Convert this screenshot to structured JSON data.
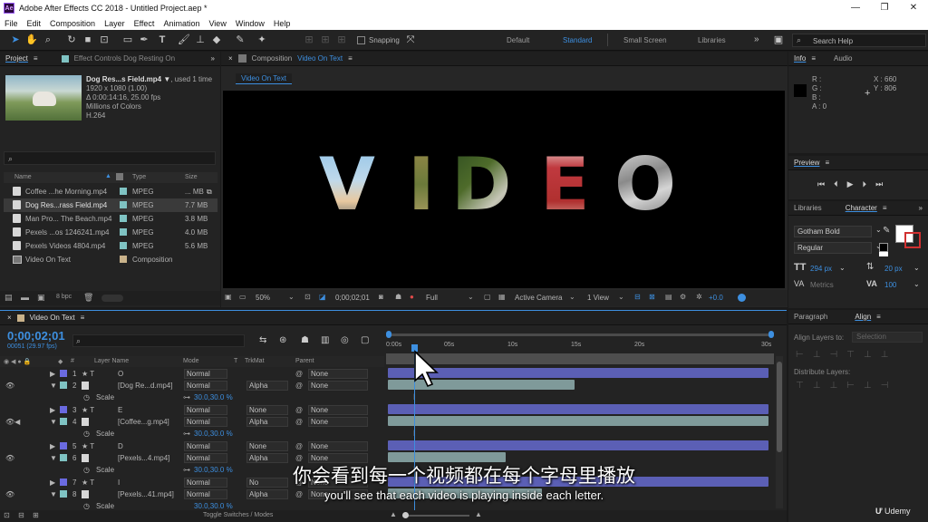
{
  "window": {
    "title": "Adobe After Effects CC 2018 - Untitled Project.aep *",
    "app_icon": "Ae",
    "minimize": "—",
    "restore": "❐",
    "close": "✕"
  },
  "menu": [
    "File",
    "Edit",
    "Composition",
    "Layer",
    "Effect",
    "Animation",
    "View",
    "Window",
    "Help"
  ],
  "toolbar": {
    "snapping": "Snapping",
    "workspaces": [
      "Default",
      "Standard",
      "Small Screen",
      "Libraries"
    ],
    "active_workspace": "Standard",
    "search_help": "Search Help"
  },
  "project": {
    "tab": "Project",
    "effect_controls": "Effect Controls Dog Resting On",
    "selected": {
      "name": "Dog Res...s Field.mp4",
      "used": ", used 1 time",
      "size": "1920 x 1080 (1.00)",
      "duration": "Δ 0:00:14:16, 25.00 fps",
      "colors": "Millions of Colors",
      "codec": "H.264"
    },
    "columns": {
      "name": "Name",
      "type": "Type",
      "size": "Size"
    },
    "items": [
      {
        "name": "Coffee ...he Morning.mp4",
        "type": "MPEG",
        "size": "... MB"
      },
      {
        "name": "Dog Res...rass Field.mp4",
        "type": "MPEG",
        "size": "7.7 MB"
      },
      {
        "name": "Man Pro... The Beach.mp4",
        "type": "MPEG",
        "size": "3.8 MB"
      },
      {
        "name": "Pexels ...os 1246241.mp4",
        "type": "MPEG",
        "size": "4.0 MB"
      },
      {
        "name": "Pexels Videos 4804.mp4",
        "type": "MPEG",
        "size": "5.6 MB"
      },
      {
        "name": "Video On Text",
        "type": "Composition",
        "size": ""
      }
    ],
    "bpc": "8 bpc"
  },
  "composition": {
    "header": "Composition",
    "name": "Video On Text",
    "tab": "Video On Text",
    "text": [
      "V",
      "I",
      "D",
      "E",
      "O"
    ],
    "zoom": "50%",
    "timecode": "0;00;02;01",
    "resolution": "Full",
    "camera": "Active Camera",
    "view": "1 View",
    "exposure": "+0.0"
  },
  "info": {
    "tab": "Info",
    "audio_tab": "Audio",
    "r": "R :",
    "g": "G :",
    "b": "B :",
    "a": "A : 0",
    "x": "X : 660",
    "y": "Y : 806"
  },
  "preview": {
    "tab": "Preview"
  },
  "character": {
    "libraries_tab": "Libraries",
    "tab": "Character",
    "font": "Gotham Bold",
    "style": "Regular",
    "size": "294 px",
    "leading": "20 px",
    "kerning": "Metrics",
    "tracking": "100"
  },
  "align": {
    "paragraph_tab": "Paragraph",
    "tab": "Align",
    "align_to_label": "Align Layers to:",
    "align_to_value": "Selection",
    "distribute": "Distribute Layers:"
  },
  "timeline": {
    "tab": "Video On Text",
    "timecode": "0;00;02;01",
    "frames": "00051 (29.97 fps)",
    "columns": {
      "layer": "Layer Name",
      "mode": "Mode",
      "t": "T",
      "trkmat": "TrkMat",
      "parent": "Parent"
    },
    "ruler": [
      "0:00s",
      "05s",
      "10s",
      "15s",
      "20s",
      "30s"
    ],
    "layers": [
      {
        "num": "1",
        "name": "O",
        "mode": "Normal",
        "trkmat": "",
        "parent": "None",
        "label": "#6a6ae0",
        "type": "text"
      },
      {
        "num": "2",
        "name": "[Dog Re...d.mp4]",
        "mode": "Normal",
        "trkmat": "Alpha",
        "parent": "None",
        "label": "#7fc3c3",
        "type": "video",
        "scale": "30.0,30.0 %"
      },
      {
        "num": "3",
        "name": "E",
        "mode": "Normal",
        "trkmat": "None",
        "parent": "None",
        "label": "#6a6ae0",
        "type": "text"
      },
      {
        "num": "4",
        "name": "[Coffee...g.mp4]",
        "mode": "Normal",
        "trkmat": "Alpha",
        "parent": "None",
        "label": "#7fc3c3",
        "type": "video",
        "scale": "30.0,30.0 %"
      },
      {
        "num": "5",
        "name": "D",
        "mode": "Normal",
        "trkmat": "None",
        "parent": "None",
        "label": "#6a6ae0",
        "type": "text"
      },
      {
        "num": "6",
        "name": "[Pexels...4.mp4]",
        "mode": "Normal",
        "trkmat": "Alpha",
        "parent": "None",
        "label": "#7fc3c3",
        "type": "video",
        "scale": "30.0,30.0 %"
      },
      {
        "num": "7",
        "name": "I",
        "mode": "Normal",
        "trkmat": "No",
        "parent": "None",
        "label": "#6a6ae0",
        "type": "text"
      },
      {
        "num": "8",
        "name": "[Pexels...41.mp4]",
        "mode": "Normal",
        "trkmat": "Alpha",
        "parent": "None",
        "label": "#7fc3c3",
        "type": "video",
        "scale": "30.0,30.0 %"
      }
    ],
    "scale_label": "Scale",
    "toggle": "Toggle Switches / Modes"
  },
  "subtitles": {
    "cn": "你会看到每一个视频都在每个字母里播放",
    "en": "you'll see that each video is playing inside each letter."
  },
  "watermark": "Udemy",
  "colors": {
    "accent": "#3d8fe0",
    "text_bar": "#5b5fb5",
    "video_bar": "#7f9a9a"
  }
}
